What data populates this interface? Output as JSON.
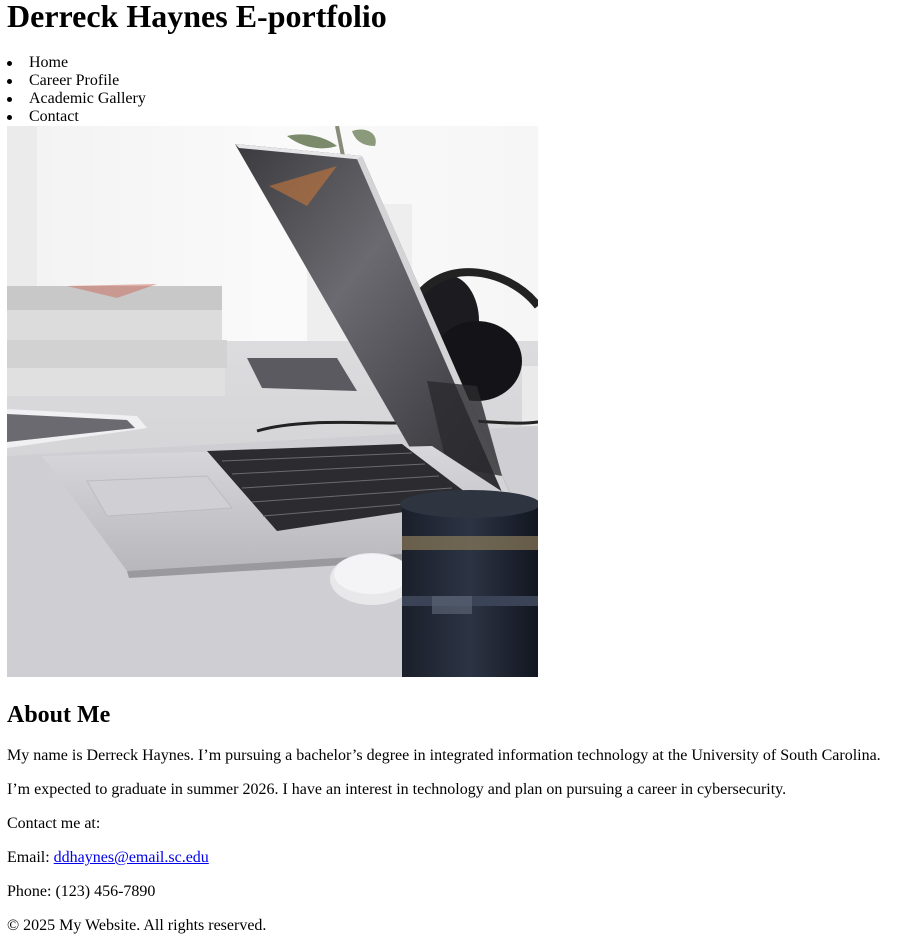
{
  "header": {
    "site_title": "Derreck Haynes E-portfolio"
  },
  "nav": {
    "items": [
      {
        "label": "Home"
      },
      {
        "label": "Career Profile"
      },
      {
        "label": "Academic Gallery"
      },
      {
        "label": "Contact"
      }
    ]
  },
  "hero_image": {
    "icon": "laptop-desk-photo"
  },
  "about": {
    "heading": "About Me",
    "paragraph_1": "My name is Derreck Haynes. I’m pursuing a bachelor’s degree in integrated information technology at the University of South Carolina.",
    "paragraph_2": "I’m expected to graduate in summer 2026. I have an interest in technology and plan on pursuing a career in cybersecurity.",
    "contact_intro": "Contact me at:",
    "email_label": "Email: ",
    "email_value": "ddhaynes@email.sc.edu",
    "phone_text": "Phone: (123) 456-7890"
  },
  "footer": {
    "copyright": "© 2025 My Website. All rights reserved."
  }
}
